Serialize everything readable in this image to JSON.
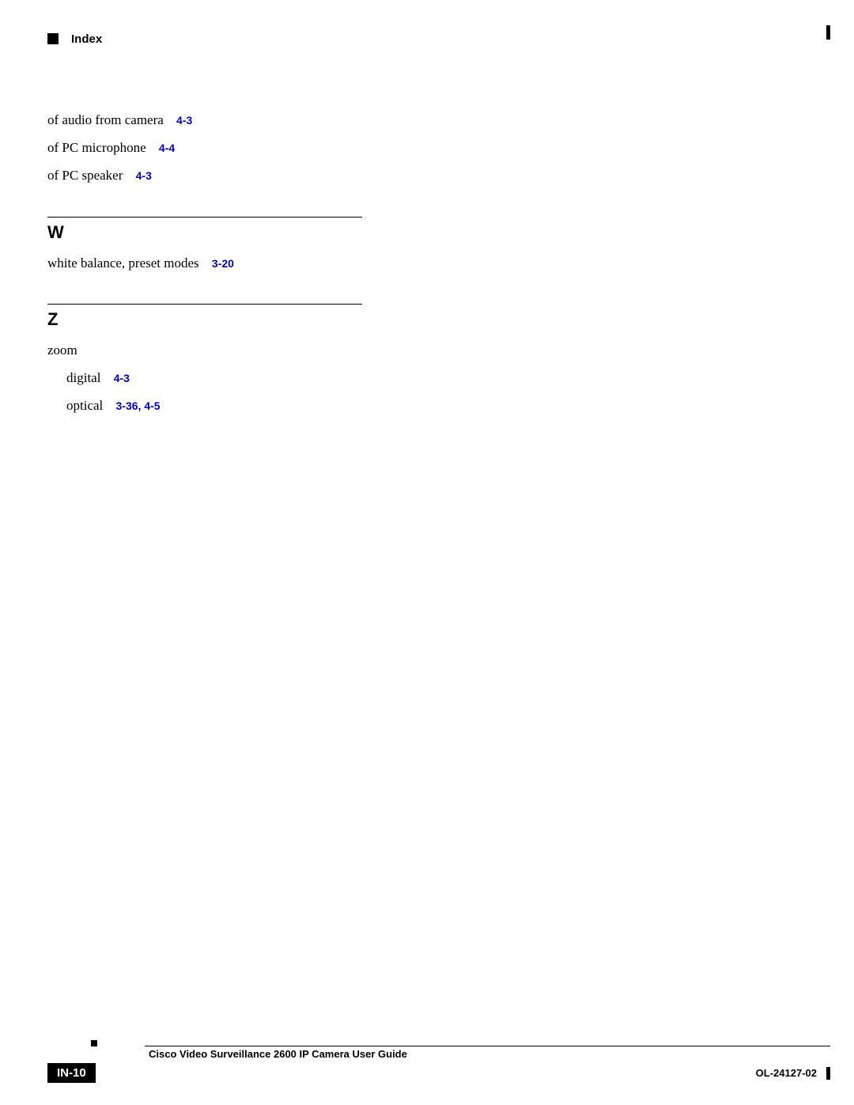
{
  "header": {
    "label": "Index"
  },
  "introLines": [
    {
      "text": "of audio from camera",
      "refs": [
        "4-3"
      ]
    },
    {
      "text": "of PC microphone",
      "refs": [
        "4-4"
      ]
    },
    {
      "text": "of PC speaker",
      "refs": [
        "4-3"
      ]
    }
  ],
  "sections": [
    {
      "letter": "W",
      "entries": [
        {
          "text": "white balance, preset modes",
          "refs": [
            "3-20"
          ],
          "sub": false
        }
      ]
    },
    {
      "letter": "Z",
      "entries": [
        {
          "text": "zoom",
          "refs": [],
          "sub": false
        },
        {
          "text": "digital",
          "refs": [
            "4-3"
          ],
          "sub": true
        },
        {
          "text": "optical",
          "refs": [
            "3-36, 4-5"
          ],
          "sub": true
        }
      ]
    }
  ],
  "footer": {
    "title": "Cisco Video Surveillance 2600 IP Camera User Guide",
    "pageNumber": "IN-10",
    "docNumber": "OL-24127-02"
  }
}
